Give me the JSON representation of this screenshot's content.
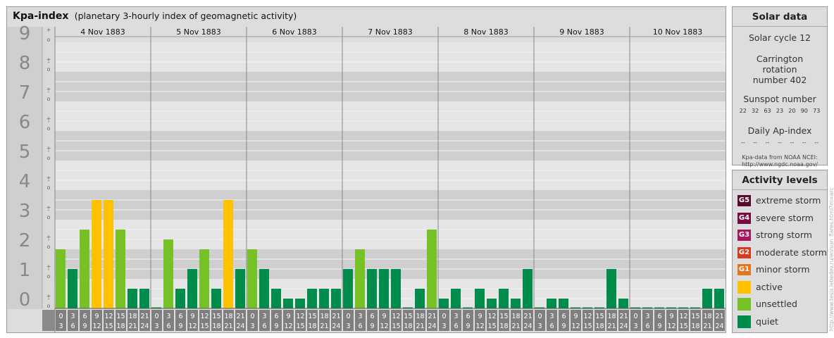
{
  "header": {
    "title": "Kpa-index",
    "subtitle": "(planetary 3-hourly index of geomagnetic activity)"
  },
  "chart_data": {
    "type": "bar",
    "title": "Kpa-index",
    "subtitle": "(planetary 3-hourly index of geomagnetic activity)",
    "days": [
      "4 Nov 1883",
      "5 Nov 1883",
      "6 Nov 1883",
      "7 Nov 1883",
      "8 Nov 1883",
      "9 Nov 1883",
      "10 Nov 1883"
    ],
    "interval_start": [
      "0",
      "3",
      "6",
      "9",
      "12",
      "15",
      "18",
      "21"
    ],
    "interval_end": [
      "3",
      "6",
      "9",
      "12",
      "15",
      "18",
      "21",
      "24"
    ],
    "y_ticks": [
      "0",
      "1",
      "2",
      "3",
      "4",
      "5",
      "6",
      "7",
      "8",
      "9"
    ],
    "y_subticks": [
      "o",
      "+",
      "-"
    ],
    "ylim": [
      0,
      9
    ],
    "values": [
      2,
      1.333,
      2.667,
      3.667,
      3.667,
      2.667,
      0.667,
      0.667,
      0,
      2.333,
      0.667,
      1.333,
      2,
      0.667,
      3.667,
      1.333,
      2,
      1.333,
      0.667,
      0.333,
      0.333,
      0.667,
      0.667,
      0.667,
      1.333,
      2,
      1.333,
      1.333,
      1.333,
      0,
      0.667,
      2.667,
      0.333,
      0.667,
      0,
      0.667,
      0.333,
      0.667,
      0.333,
      1.333,
      0,
      0.333,
      0.333,
      0,
      0,
      0,
      1.333,
      0.333,
      0,
      0,
      0,
      0,
      0,
      0,
      0.667,
      0.667
    ],
    "colors": {
      "quiet": "#008d4b",
      "unsettled": "#76c125",
      "active": "#ffc200"
    }
  },
  "solar": {
    "title": "Solar data",
    "cycle": "Solar cycle 12",
    "carrington": "Carrington rotation number 402",
    "sunspot_label": "Sunspot number",
    "sunspots": [
      "22",
      "32",
      "63",
      "23",
      "20",
      "90",
      "73"
    ],
    "ap_label": "Daily Ap-index",
    "ap_values": [
      "--",
      "--",
      "--",
      "--",
      "--",
      "--",
      "--"
    ],
    "source_line1": "Kpa-data from NOAA NCEI:",
    "source_line2": "http://www.ngdc.noaa.gov/"
  },
  "levels": {
    "title": "Activity levels",
    "items": [
      {
        "badge": "G5",
        "label": "extreme storm",
        "color": "#5b0a2d"
      },
      {
        "badge": "G4",
        "label": "severe storm",
        "color": "#7b0a43"
      },
      {
        "badge": "G3",
        "label": "strong storm",
        "color": "#a8155f"
      },
      {
        "badge": "G2",
        "label": "moderate storm",
        "color": "#d73a1c"
      },
      {
        "badge": "G1",
        "label": "minor storm",
        "color": "#e6761e"
      },
      {
        "badge": "",
        "label": "active",
        "color": "#ffc200"
      },
      {
        "badge": "",
        "label": "unsettled",
        "color": "#76c125"
      },
      {
        "badge": "",
        "label": "quiet",
        "color": "#008d4b"
      }
    ]
  },
  "credit": "http://www.tesis.lebedev.ru/en/sun_flares.html?m=arc"
}
